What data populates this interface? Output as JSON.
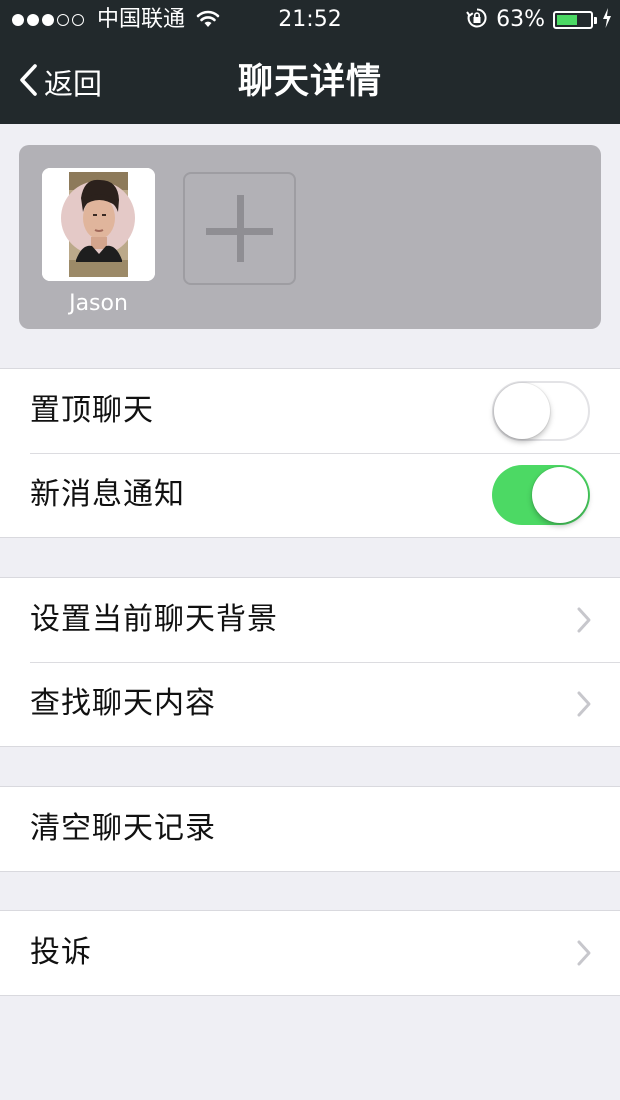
{
  "status_bar": {
    "signal_dots_filled": 3,
    "signal_dots_total": 5,
    "carrier": "中国联通",
    "time": "21:52",
    "battery_percent": "63%",
    "battery_level": 0.63
  },
  "nav": {
    "back_label": "返回",
    "title": "聊天详情"
  },
  "members": [
    {
      "name": "Jason"
    }
  ],
  "settings": {
    "pin_chat": {
      "label": "置顶聊天",
      "on": false
    },
    "notifications": {
      "label": "新消息通知",
      "on": true
    },
    "chat_background": {
      "label": "设置当前聊天背景"
    },
    "search_content": {
      "label": "查找聊天内容"
    },
    "clear_history": {
      "label": "清空聊天记录"
    },
    "report": {
      "label": "投诉"
    }
  },
  "colors": {
    "nav_background": "#22292c",
    "page_background": "#efeff4",
    "toggle_on": "#4cd964",
    "members_card": "#b2b1b6"
  }
}
